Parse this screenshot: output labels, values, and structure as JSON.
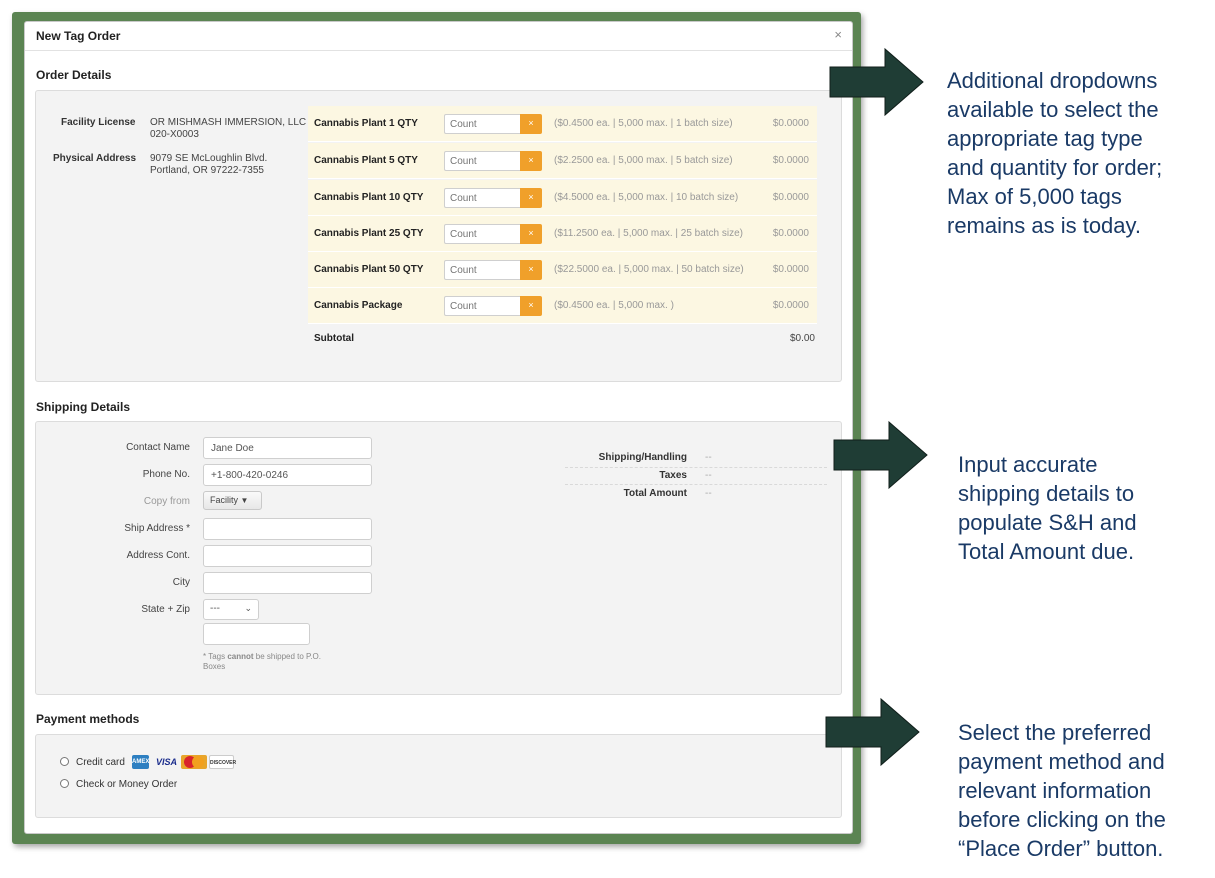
{
  "modal": {
    "title": "New Tag Order",
    "close": "×"
  },
  "order": {
    "section_title": "Order Details",
    "facility_license_label": "Facility License",
    "facility_license_line1": "OR MISHMASH IMMERSION, LLC",
    "facility_license_line2": "020-X0003",
    "physical_address_label": "Physical Address",
    "physical_address_line1": "9079 SE McLoughlin Blvd.",
    "physical_address_line2": "Portland, OR 97222-7355",
    "tags": [
      {
        "name": "Cannabis Plant 1 QTY",
        "placeholder": "Count",
        "clear": "×",
        "info": "($0.4500 ea. | 5,000 max. | 1 batch size)",
        "price": "$0.0000"
      },
      {
        "name": "Cannabis Plant 5 QTY",
        "placeholder": "Count",
        "clear": "×",
        "info": "($2.2500 ea. | 5,000 max. | 5 batch size)",
        "price": "$0.0000"
      },
      {
        "name": "Cannabis Plant 10 QTY",
        "placeholder": "Count",
        "clear": "×",
        "info": "($4.5000 ea. | 5,000 max. | 10 batch size)",
        "price": "$0.0000"
      },
      {
        "name": "Cannabis Plant 25 QTY",
        "placeholder": "Count",
        "clear": "×",
        "info": "($11.2500 ea. | 5,000 max. | 25 batch size)",
        "price": "$0.0000"
      },
      {
        "name": "Cannabis Plant 50 QTY",
        "placeholder": "Count",
        "clear": "×",
        "info": "($22.5000 ea. | 5,000 max. | 50 batch size)",
        "price": "$0.0000"
      },
      {
        "name": "Cannabis Package",
        "placeholder": "Count",
        "clear": "×",
        "info": "($0.4500 ea. | 5,000 max. )",
        "price": "$0.0000"
      }
    ],
    "subtotal_label": "Subtotal",
    "subtotal_value": "$0.00"
  },
  "shipping": {
    "section_title": "Shipping Details",
    "contact_name_label": "Contact Name",
    "contact_name_value": "Jane Doe",
    "phone_label": "Phone No.",
    "phone_value": "+1-800-420-0246",
    "copy_from_label": "Copy from",
    "copy_from_button": "Facility",
    "ship_address_label": "Ship Address *",
    "address_cont_label": "Address Cont.",
    "city_label": "City",
    "state_zip_label": "State + Zip",
    "state_value": "---",
    "note_pre": "* Tags ",
    "note_bold": "cannot",
    "note_post": " be shipped to P.O. Boxes",
    "shipping_handling_label": "Shipping/Handling",
    "shipping_handling_value": "--",
    "taxes_label": "Taxes",
    "taxes_value": "--",
    "total_label": "Total Amount",
    "total_value": "--"
  },
  "payment": {
    "section_title": "Payment methods",
    "credit_card_label": "Credit card",
    "check_label": "Check or Money Order",
    "cards": [
      "AMEX",
      "VISA",
      "MasterCard",
      "DISCOVER"
    ]
  },
  "annotations": {
    "arrow_color": "#1f3d35",
    "text_color": "#1a3a66",
    "note1": [
      "Additional dropdowns",
      "available to select the",
      "appropriate tag type",
      "and quantity for order;",
      "Max of 5,000 tags",
      "remains as is today."
    ],
    "note2": [
      "Input accurate",
      "shipping details to",
      "populate S&H and",
      "Total Amount due."
    ],
    "note3": [
      "Select the preferred",
      "payment method and",
      "relevant information",
      "before clicking on the",
      "“Place Order” button."
    ]
  }
}
